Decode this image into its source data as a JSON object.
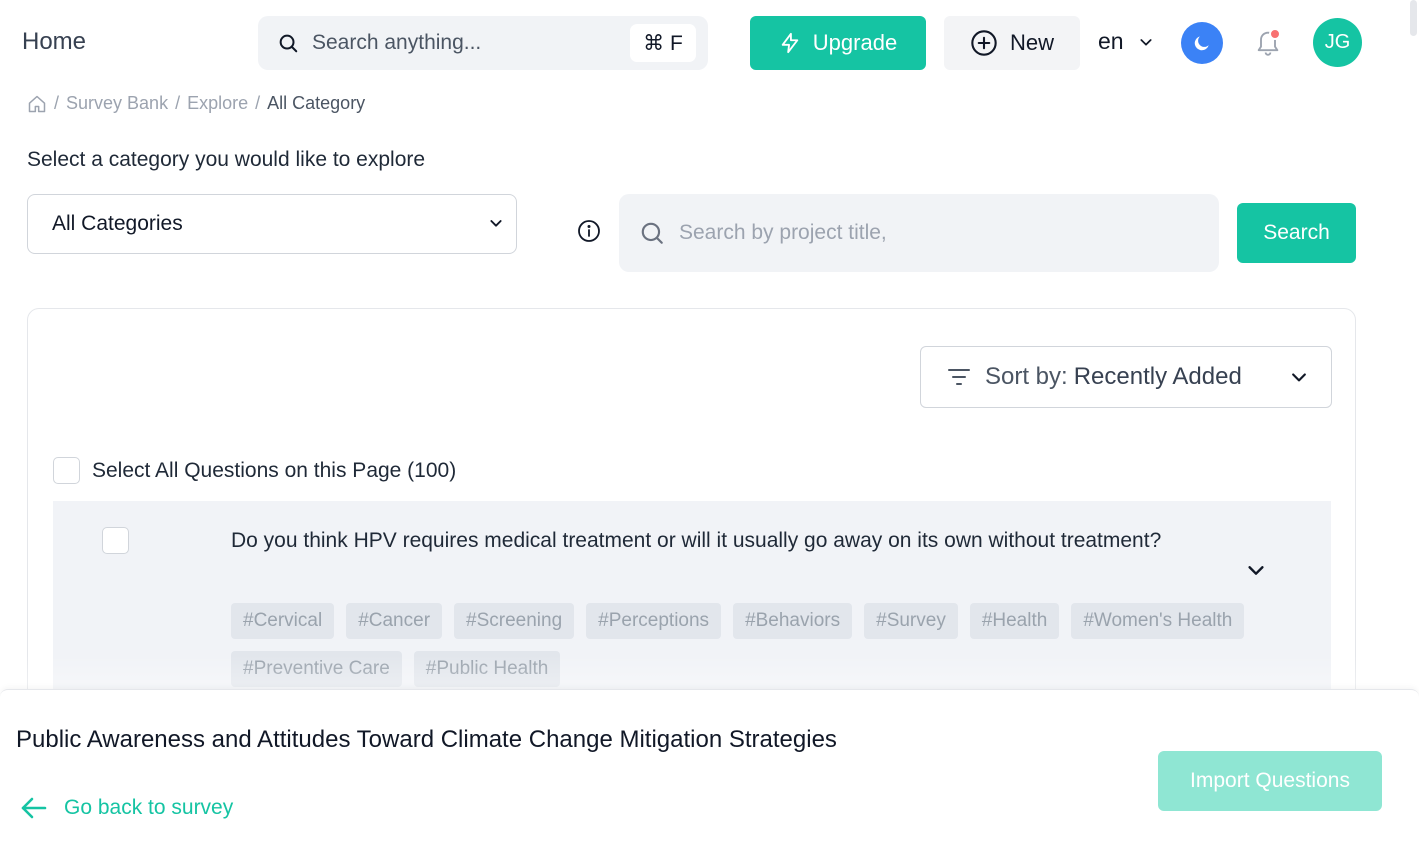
{
  "header": {
    "title": "Home",
    "search_placeholder": "Search anything...",
    "shortcut": "⌘ F",
    "upgrade_label": "Upgrade",
    "new_label": "New",
    "language": "en",
    "avatar_initials": "JG",
    "notification_unread": true
  },
  "breadcrumb": {
    "items": [
      "Survey Bank",
      "Explore",
      "All Category"
    ]
  },
  "explore": {
    "prompt": "Select a category you would like to explore",
    "category_selected": "All Categories",
    "project_search_placeholder": "Search by project title,",
    "search_label": "Search"
  },
  "results": {
    "sort_prefix": "Sort by:",
    "sort_value": "Recently Added",
    "select_all_label": "Select All Questions on this Page (100)",
    "questions": [
      {
        "text": "Do you think HPV requires medical treatment or will it usually go away on its own without treatment?",
        "tags": [
          "#Cervical",
          "#Cancer",
          "#Screening",
          "#Perceptions",
          "#Behaviors",
          "#Survey",
          "#Health",
          "#Women's Health",
          "#Preventive Care",
          "#Public Health"
        ]
      }
    ]
  },
  "footer": {
    "survey_title": "Public Awareness and Attitudes Toward Climate Change Mitigation Strategies",
    "go_back_label": "Go back to survey",
    "import_label": "Import Questions"
  },
  "colors": {
    "accent": "#15c4a3",
    "accent_disabled": "#8fe6d3",
    "theme_toggle": "#3b82f6",
    "notification_dot": "#f87171"
  }
}
